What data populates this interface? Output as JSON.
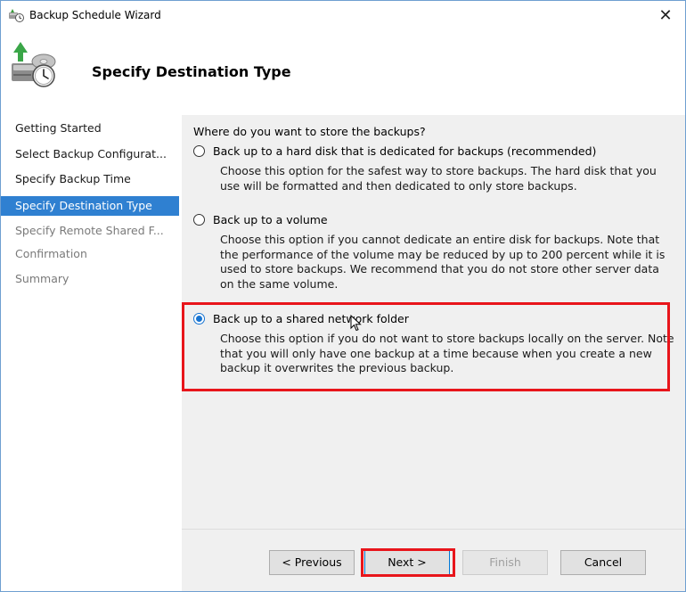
{
  "window": {
    "title": "Backup Schedule Wizard",
    "close_glyph": "✕"
  },
  "header": {
    "title": "Specify Destination Type",
    "icon": "backup-wizard-icon"
  },
  "nav": {
    "items": [
      {
        "label": "Getting Started",
        "state": "done"
      },
      {
        "label": "Select Backup Configurat...",
        "state": "done"
      },
      {
        "label": "Specify Backup Time",
        "state": "done"
      },
      {
        "label": "Specify Destination Type",
        "state": "selected"
      },
      {
        "label": "Specify Remote Shared F...",
        "state": "pending"
      },
      {
        "label": "Confirmation",
        "state": "pending"
      },
      {
        "label": "Summary",
        "state": "pending"
      }
    ]
  },
  "content": {
    "question": "Where do you want to store the backups?",
    "options": [
      {
        "label": "Back up to a hard disk that is dedicated for backups (recommended)",
        "description": "Choose this option for the safest way to store backups. The hard disk that you use will be formatted and then dedicated to only store backups.",
        "selected": false
      },
      {
        "label": "Back up to a volume",
        "description": "Choose this option if you cannot dedicate an entire disk for backups. Note that the performance of the volume may be reduced by up to 200 percent while it is used to store backups. We recommend that you do not store other server data on the same volume.",
        "selected": false
      },
      {
        "label": "Back up to a shared network folder",
        "description": "Choose this option if you do not want to store backups locally on the server. Note that you will only have one backup at a time because when you create a new backup it overwrites the previous backup.",
        "selected": true
      }
    ]
  },
  "buttons": {
    "previous": "< Previous",
    "next": "Next >",
    "finish": "Finish",
    "cancel": "Cancel"
  },
  "colors": {
    "selection": "#2f80d1",
    "highlight": "#e8151b",
    "content_bg": "#f0f0f0"
  }
}
